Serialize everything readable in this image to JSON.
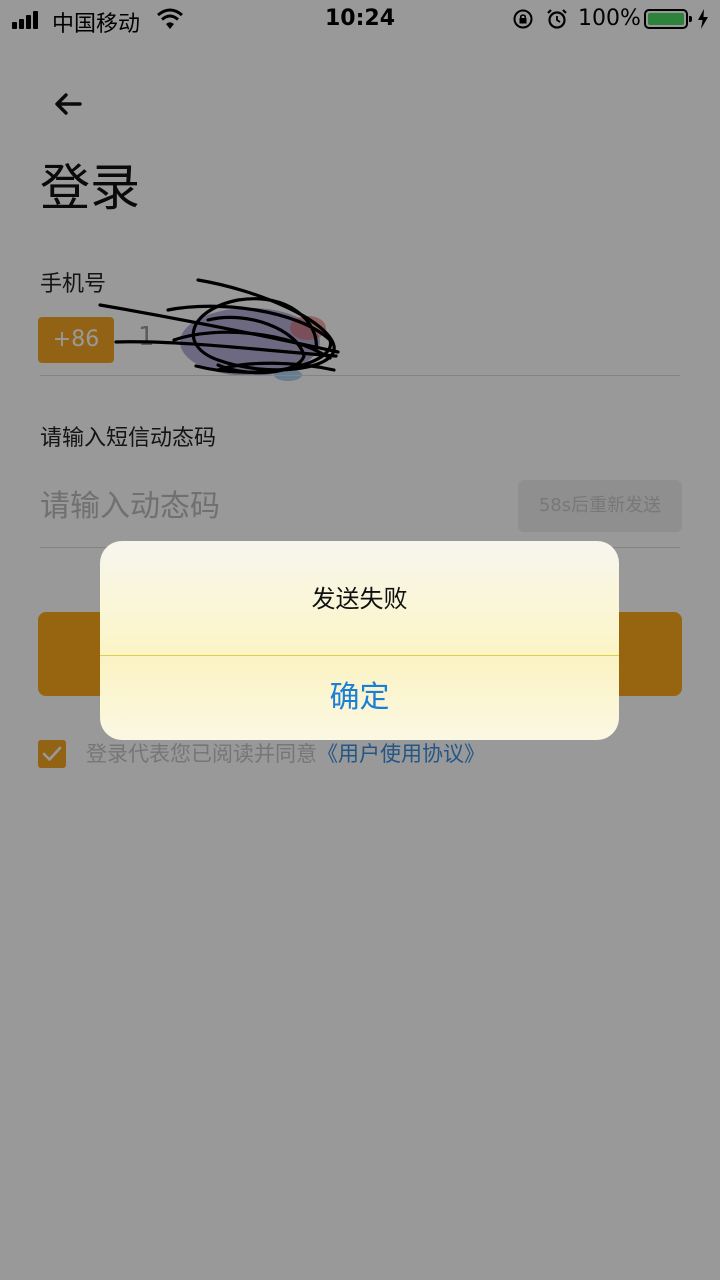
{
  "status_bar": {
    "carrier": "中国移动",
    "time": "10:24",
    "battery_percent": "100%"
  },
  "page": {
    "title": "登录",
    "phone_label": "手机号",
    "country_code": "+86",
    "phone_value": "1",
    "code_label": "请输入短信动态码",
    "code_placeholder": "请输入动态码",
    "resend_label": "58s后重新发送",
    "agree_text": "登录代表您已阅读并同意",
    "agree_link": "《用户使用协议》",
    "agree_checked": true
  },
  "alert": {
    "message": "发送失败",
    "confirm_label": "确定"
  },
  "colors": {
    "accent": "#f5a623",
    "link": "#3b8fe0",
    "alert_button": "#1a7fd6"
  },
  "icons": [
    "signal-icon",
    "wifi-icon",
    "rotation-lock-icon",
    "alarm-icon",
    "battery-icon",
    "charging-icon",
    "back-arrow-icon",
    "checkmark-icon"
  ]
}
